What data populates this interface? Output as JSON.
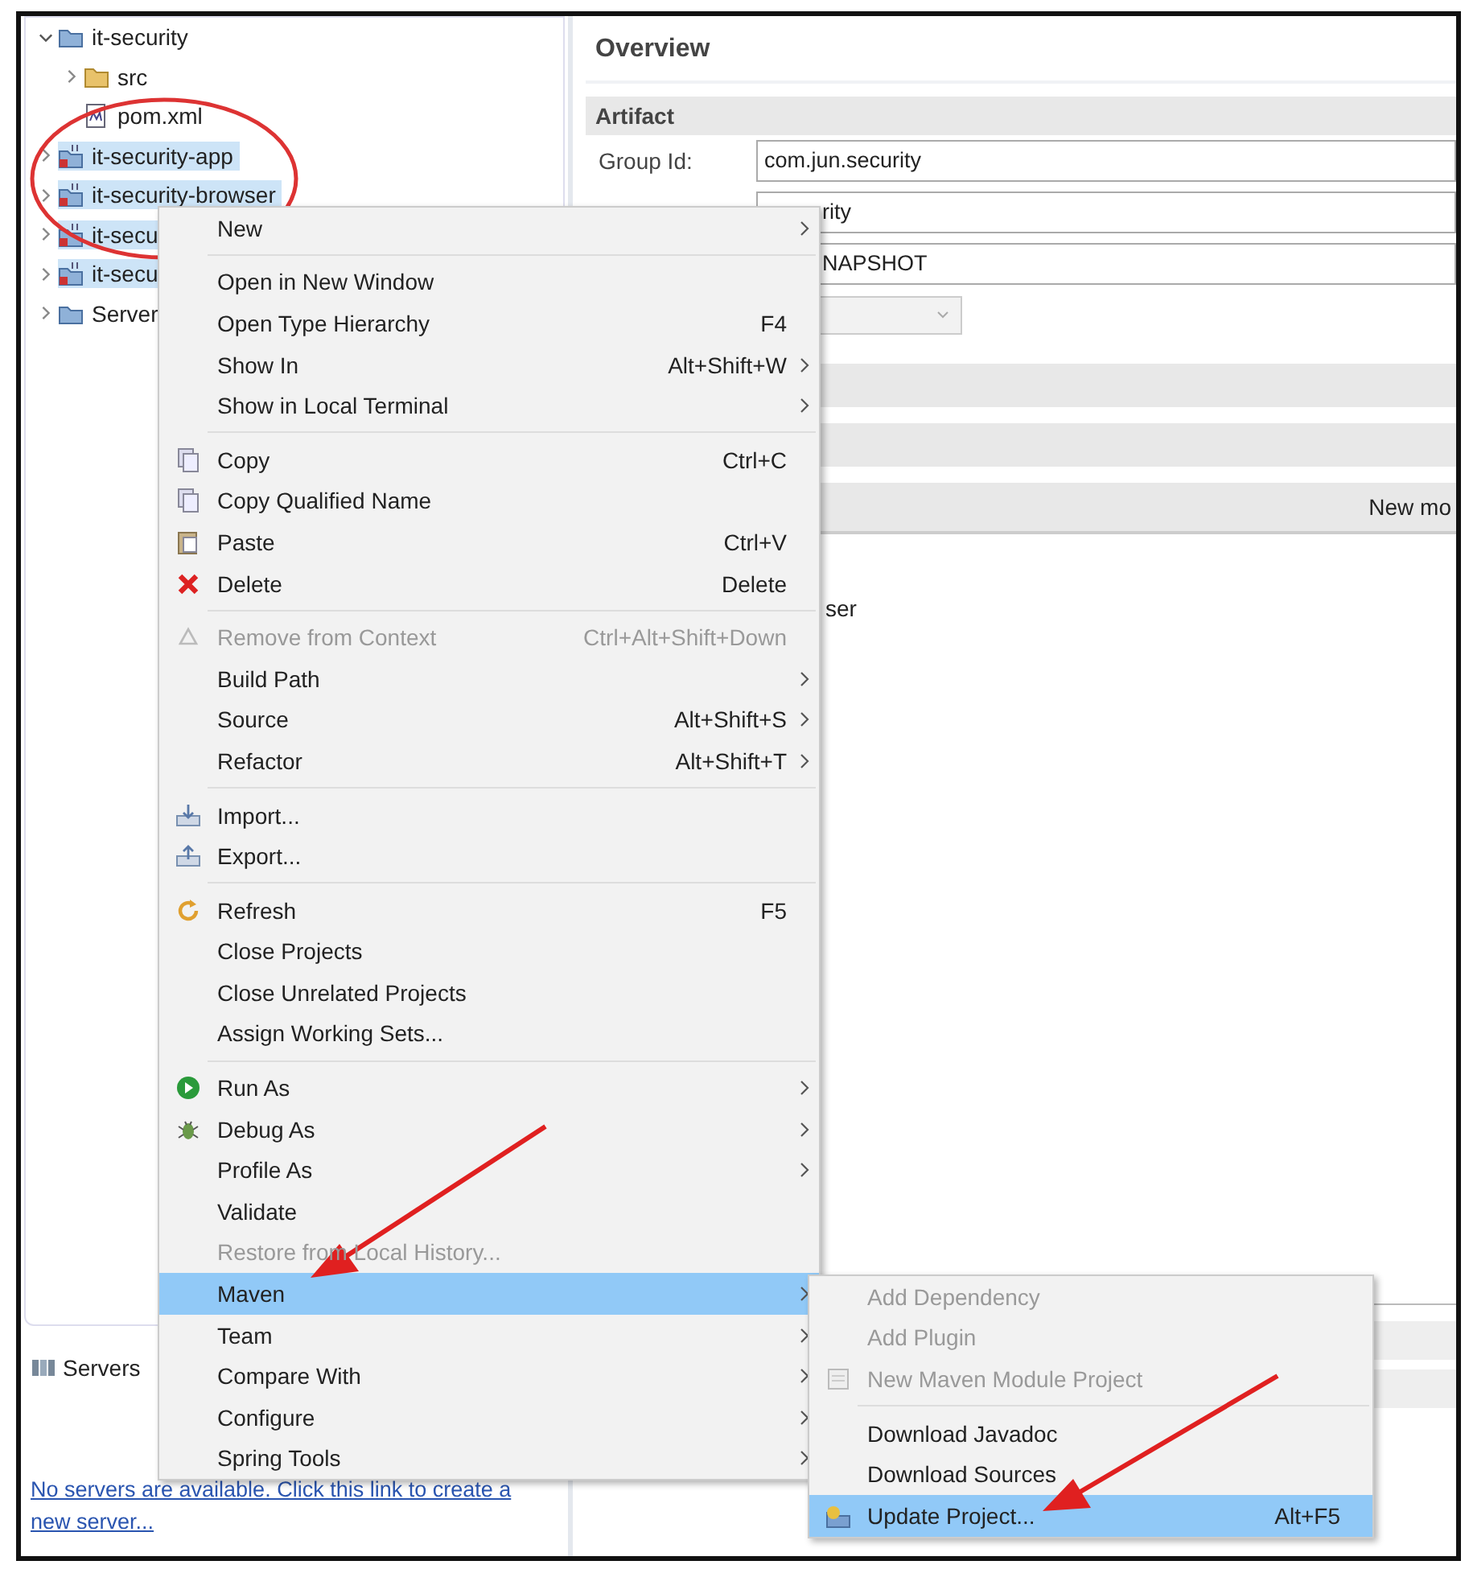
{
  "explorer": {
    "items": [
      {
        "label": "it-security",
        "kind": "project",
        "expanded": true,
        "selected": false,
        "children": [
          {
            "label": "src",
            "kind": "folder",
            "expanded": false,
            "selected": false
          },
          {
            "label": "pom.xml",
            "kind": "file",
            "selected": false
          }
        ]
      },
      {
        "label": "it-security-app",
        "kind": "module",
        "expanded": false,
        "selected": true
      },
      {
        "label": "it-security-browser",
        "kind": "module",
        "expanded": false,
        "selected": true
      },
      {
        "label": "it-secu",
        "kind": "module",
        "expanded": false,
        "selected": true
      },
      {
        "label": "it-secu",
        "kind": "module",
        "expanded": false,
        "selected": true
      },
      {
        "label": "Server",
        "kind": "project",
        "expanded": false,
        "selected": false
      }
    ]
  },
  "servers_view": {
    "tab": "Servers",
    "link": "No servers are available. Click this link to create a new server..."
  },
  "editor": {
    "title": "Overview",
    "section": "Artifact",
    "fields": [
      {
        "label": "Group Id:",
        "value": "com.jun.security",
        "kind": "text"
      },
      {
        "value": "rity",
        "kind": "text"
      },
      {
        "value": "NAPSHOT",
        "kind": "text"
      },
      {
        "kind": "dropdown"
      }
    ],
    "bar_label": "New mo",
    "fragment": "ser"
  },
  "context_menu": {
    "items": [
      {
        "kind": "plain",
        "label": "New",
        "submenu": true,
        "selected": false,
        "disabled": false
      },
      {
        "kind": "separator"
      },
      {
        "kind": "plain",
        "label": "Open in New Window",
        "selected": false,
        "disabled": false
      },
      {
        "kind": "plain",
        "label": "Open Type Hierarchy",
        "shortcut": "F4",
        "selected": false,
        "disabled": false
      },
      {
        "kind": "plain",
        "label": "Show In",
        "shortcut": "Alt+Shift+W",
        "submenu": true,
        "selected": false,
        "disabled": false
      },
      {
        "kind": "plain",
        "label": "Show in Local Terminal",
        "submenu": true,
        "selected": false,
        "disabled": false
      },
      {
        "kind": "separator"
      },
      {
        "kind": "copy",
        "label": "Copy",
        "shortcut": "Ctrl+C",
        "selected": false,
        "disabled": false
      },
      {
        "kind": "copy",
        "label": "Copy Qualified Name",
        "selected": false,
        "disabled": false
      },
      {
        "kind": "paste",
        "label": "Paste",
        "shortcut": "Ctrl+V",
        "selected": false,
        "disabled": false
      },
      {
        "kind": "delete",
        "label": "Delete",
        "shortcut": "Delete",
        "selected": false,
        "disabled": false
      },
      {
        "kind": "separator"
      },
      {
        "kind": "remove",
        "label": "Remove from Context",
        "shortcut": "Ctrl+Alt+Shift+Down",
        "selected": false,
        "disabled": true
      },
      {
        "kind": "plain",
        "label": "Build Path",
        "submenu": true,
        "selected": false,
        "disabled": false
      },
      {
        "kind": "plain",
        "label": "Source",
        "shortcut": "Alt+Shift+S",
        "submenu": true,
        "selected": false,
        "disabled": false
      },
      {
        "kind": "plain",
        "label": "Refactor",
        "shortcut": "Alt+Shift+T",
        "submenu": true,
        "selected": false,
        "disabled": false
      },
      {
        "kind": "separator"
      },
      {
        "kind": "import",
        "label": "Import...",
        "selected": false,
        "disabled": false
      },
      {
        "kind": "export",
        "label": "Export...",
        "selected": false,
        "disabled": false
      },
      {
        "kind": "separator"
      },
      {
        "kind": "refresh",
        "label": "Refresh",
        "shortcut": "F5",
        "selected": false,
        "disabled": false
      },
      {
        "kind": "plain",
        "label": "Close Projects",
        "selected": false,
        "disabled": false
      },
      {
        "kind": "plain",
        "label": "Close Unrelated Projects",
        "selected": false,
        "disabled": false
      },
      {
        "kind": "plain",
        "label": "Assign Working Sets...",
        "selected": false,
        "disabled": false
      },
      {
        "kind": "separator"
      },
      {
        "kind": "run",
        "label": "Run As",
        "submenu": true,
        "selected": false,
        "disabled": false
      },
      {
        "kind": "debug",
        "label": "Debug As",
        "submenu": true,
        "selected": false,
        "disabled": false
      },
      {
        "kind": "plain",
        "label": "Profile As",
        "submenu": true,
        "selected": false,
        "disabled": false
      },
      {
        "kind": "plain",
        "label": "Validate",
        "selected": false,
        "disabled": false
      },
      {
        "kind": "plain",
        "label": "Restore from Local History...",
        "selected": false,
        "disabled": true
      },
      {
        "kind": "plain",
        "label": "Maven",
        "submenu": true,
        "selected": true,
        "disabled": false
      },
      {
        "kind": "plain",
        "label": "Team",
        "submenu": true,
        "selected": false,
        "disabled": false
      },
      {
        "kind": "plain",
        "label": "Compare With",
        "submenu": true,
        "selected": false,
        "disabled": false
      },
      {
        "kind": "plain",
        "label": "Configure",
        "submenu": true,
        "selected": false,
        "disabled": false
      },
      {
        "kind": "plain",
        "label": "Spring Tools",
        "submenu": true,
        "selected": false,
        "disabled": false
      }
    ]
  },
  "maven_submenu": {
    "items": [
      {
        "kind": "plain",
        "label": "Add Dependency",
        "selected": false,
        "disabled": true
      },
      {
        "kind": "plain",
        "label": "Add Plugin",
        "selected": false,
        "disabled": true
      },
      {
        "kind": "module",
        "label": "New Maven Module Project",
        "selected": false,
        "disabled": true
      },
      {
        "kind": "separator"
      },
      {
        "kind": "plain",
        "label": "Download Javadoc",
        "selected": false,
        "disabled": false
      },
      {
        "kind": "plain",
        "label": "Download Sources",
        "selected": false,
        "disabled": false
      },
      {
        "kind": "update",
        "label": "Update Project...",
        "shortcut": "Alt+F5",
        "selected": true,
        "disabled": false
      }
    ]
  }
}
